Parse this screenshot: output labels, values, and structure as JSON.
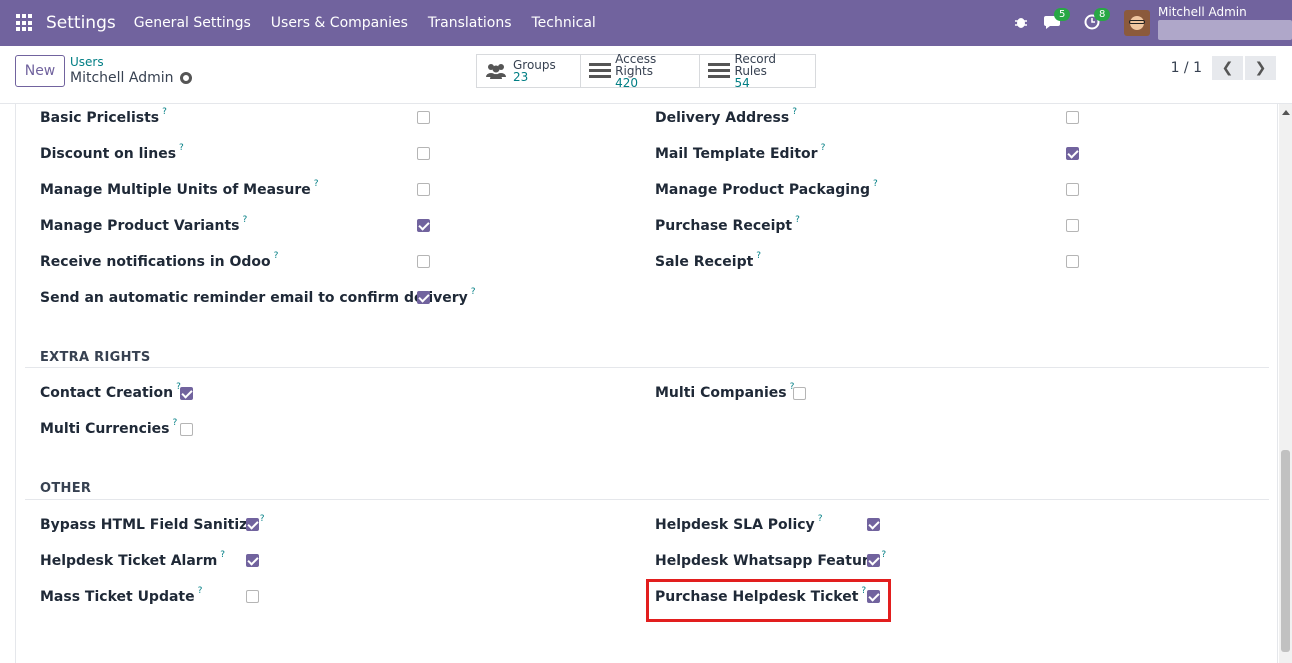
{
  "navbar": {
    "brand": "Settings",
    "menu": [
      "General Settings",
      "Users & Companies",
      "Translations",
      "Technical"
    ],
    "messages_count": "5",
    "activities_count": "8",
    "user_name": "Mitchell Admin",
    "accent": "#71639e"
  },
  "control": {
    "new_label": "New",
    "breadcrumb_parent": "Users",
    "breadcrumb_current": "Mitchell Admin",
    "smart_buttons": [
      {
        "label": "Groups",
        "value": "23",
        "icon": "users-icon"
      },
      {
        "label": "Access Rights",
        "value": "420",
        "icon": "list-icon"
      },
      {
        "label": "Record Rules",
        "value": "54",
        "icon": "list-icon"
      }
    ],
    "pager": "1 / 1"
  },
  "left_rows": [
    {
      "label": "Basic Pricelists",
      "checked": false
    },
    {
      "label": "Discount on lines",
      "checked": false
    },
    {
      "label": "Manage Multiple Units of Measure",
      "checked": false
    },
    {
      "label": "Manage Product Variants",
      "checked": true
    },
    {
      "label": "Receive notifications in Odoo",
      "checked": false
    },
    {
      "label": "Send an automatic reminder email to confirm delivery",
      "checked": true
    }
  ],
  "right_rows": [
    {
      "label": "Delivery Address",
      "checked": false
    },
    {
      "label": "Mail Template Editor",
      "checked": true
    },
    {
      "label": "Manage Product Packaging",
      "checked": false
    },
    {
      "label": "Purchase Receipt",
      "checked": false
    },
    {
      "label": "Sale Receipt",
      "checked": false
    }
  ],
  "extra_rights": {
    "title": "EXTRA RIGHTS",
    "rows": [
      {
        "label": "Contact Creation",
        "checked": true
      },
      {
        "label": "Multi Currencies",
        "checked": false
      },
      {
        "label": "Multi Companies",
        "checked": false
      }
    ]
  },
  "other": {
    "title": "OTHER",
    "rows": [
      {
        "label": "Bypass HTML Field Sanitize",
        "checked": true
      },
      {
        "label": "Helpdesk Ticket Alarm",
        "checked": true
      },
      {
        "label": "Mass Ticket Update",
        "checked": false
      },
      {
        "label": "Helpdesk SLA Policy",
        "checked": true
      },
      {
        "label": "Helpdesk Whatsapp Feature",
        "checked": true
      },
      {
        "label": "Purchase Helpdesk Ticket",
        "checked": true
      }
    ]
  },
  "help_mark": "?"
}
